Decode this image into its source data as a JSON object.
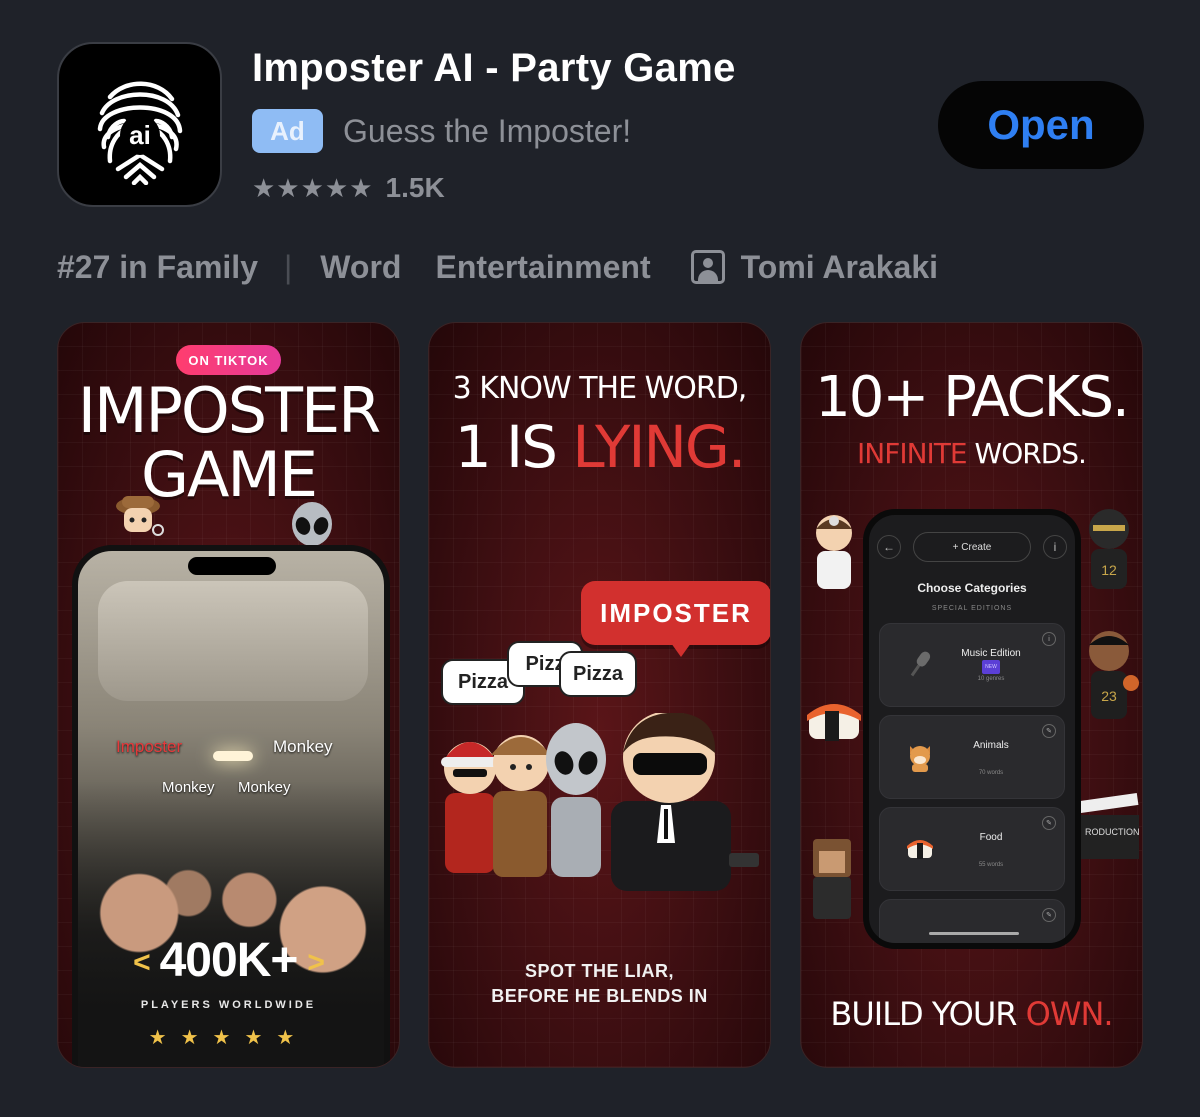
{
  "app": {
    "title": "Imposter AI - Party Game",
    "ad_label": "Ad",
    "subtitle": "Guess the Imposter!",
    "stars": "★★★★★",
    "rating_count": "1.5K",
    "open_label": "Open",
    "icon_text": "ai"
  },
  "meta": {
    "rank": "#27 in Family",
    "separator": "|",
    "tag1": "Word",
    "tag2": "Entertainment",
    "developer": "Tomi Arakaki"
  },
  "shot1": {
    "badge": "ON TIKTOK",
    "title_line1": "IMPOSTER",
    "title_line2": "GAME",
    "label_imposter": "Imposter",
    "label_monkey_a": "Monkey",
    "label_monkey_b": "Monkey",
    "label_monkey_c": "Monkey",
    "chev_left": "<",
    "count": "400K+",
    "chev_right": ">",
    "players": "PLAYERS WORLDWIDE",
    "stars": "★★★★★"
  },
  "shot2": {
    "line1": "3 KNOW THE WORD,",
    "line2_white": "1 IS ",
    "line2_red": "LYING.",
    "bubble": "IMPOSTER",
    "pizza1": "Pizza",
    "pizza2": "Pizz",
    "pizza3": "Pizza",
    "bottom_line1": "SPOT THE LIAR,",
    "bottom_line2": "BEFORE HE BLENDS IN"
  },
  "shot3": {
    "line1": "10+ PACKS.",
    "line2_red": "INFINITE",
    "line2_white": " WORDS.",
    "back": "←",
    "create": "+ Create",
    "info": "i",
    "choose": "Choose Categories",
    "special": "SPECIAL EDITIONS",
    "categories": [
      {
        "name": "Music Edition",
        "tag": "NEW",
        "sub": "10 genres"
      },
      {
        "name": "Animals",
        "sub": "70 words"
      },
      {
        "name": "Food",
        "sub": "55 words"
      }
    ],
    "build_white": "BUILD YOUR ",
    "build_red": "OWN."
  },
  "colors": {
    "background": "#1f2229",
    "accent_blue": "#2f7ff2",
    "ad_badge": "#8fbcf4",
    "muted_text": "#8d9097",
    "red": "#e03a36"
  }
}
